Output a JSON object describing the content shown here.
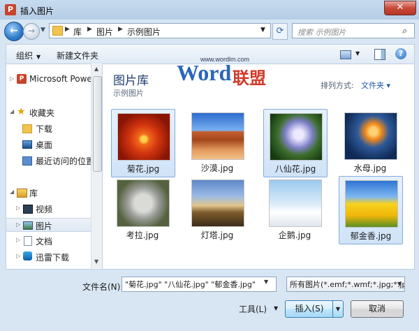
{
  "window": {
    "title": "插入图片",
    "close_label": "✕"
  },
  "navigation": {
    "back_label": "←",
    "forward_label": "→",
    "breadcrumbs": [
      "库",
      "图片",
      "示例图片"
    ],
    "search_placeholder": "搜索 示例图片"
  },
  "toolbar": {
    "organize_label": "组织",
    "new_folder_label": "新建文件夹",
    "help_label": "?"
  },
  "sidebar": {
    "items": [
      {
        "label": "Microsoft Powerl",
        "icon": "powerpoint-icon"
      },
      {
        "label": "收藏夹",
        "icon": "star-icon"
      },
      {
        "label": "下载",
        "icon": "download-folder-icon"
      },
      {
        "label": "桌面",
        "icon": "desktop-icon"
      },
      {
        "label": "最近访问的位置",
        "icon": "recent-places-icon"
      },
      {
        "label": "库",
        "icon": "library-icon"
      },
      {
        "label": "视频",
        "icon": "video-icon"
      },
      {
        "label": "图片",
        "icon": "pictures-icon"
      },
      {
        "label": "文档",
        "icon": "documents-icon"
      },
      {
        "label": "迅雷下载",
        "icon": "thunder-download-icon"
      }
    ]
  },
  "main": {
    "library_title": "图片库",
    "library_subtitle": "示例图片",
    "arrange_label": "排列方式:",
    "arrange_value": "文件夹 ▾",
    "files": [
      {
        "name": "菊花.jpg",
        "selected": true
      },
      {
        "name": "沙漠.jpg",
        "selected": false
      },
      {
        "name": "八仙花.jpg",
        "selected": true
      },
      {
        "name": "水母.jpg",
        "selected": false
      },
      {
        "name": "考拉.jpg",
        "selected": false
      },
      {
        "name": "灯塔.jpg",
        "selected": false
      },
      {
        "name": "企鹅.jpg",
        "selected": false
      },
      {
        "name": "郁金香.jpg",
        "selected": true
      }
    ]
  },
  "footer": {
    "filename_label": "文件名(N):",
    "filename_value": "\"菊花.jpg\" \"八仙花.jpg\" \"郁金香.jpg\"",
    "filetype_value": "所有图片(*.emf;*.wmf;*.jpg;*.jp",
    "tools_label": "工具(L)",
    "insert_label": "插入(S)",
    "cancel_label": "取消"
  },
  "watermark": {
    "url": "www.wordlm.com",
    "word": "Word",
    "cn": "联盟"
  },
  "colors": {
    "accent": "#1f59a6",
    "selection": "#cfe3f8",
    "close": "#c9493a"
  }
}
